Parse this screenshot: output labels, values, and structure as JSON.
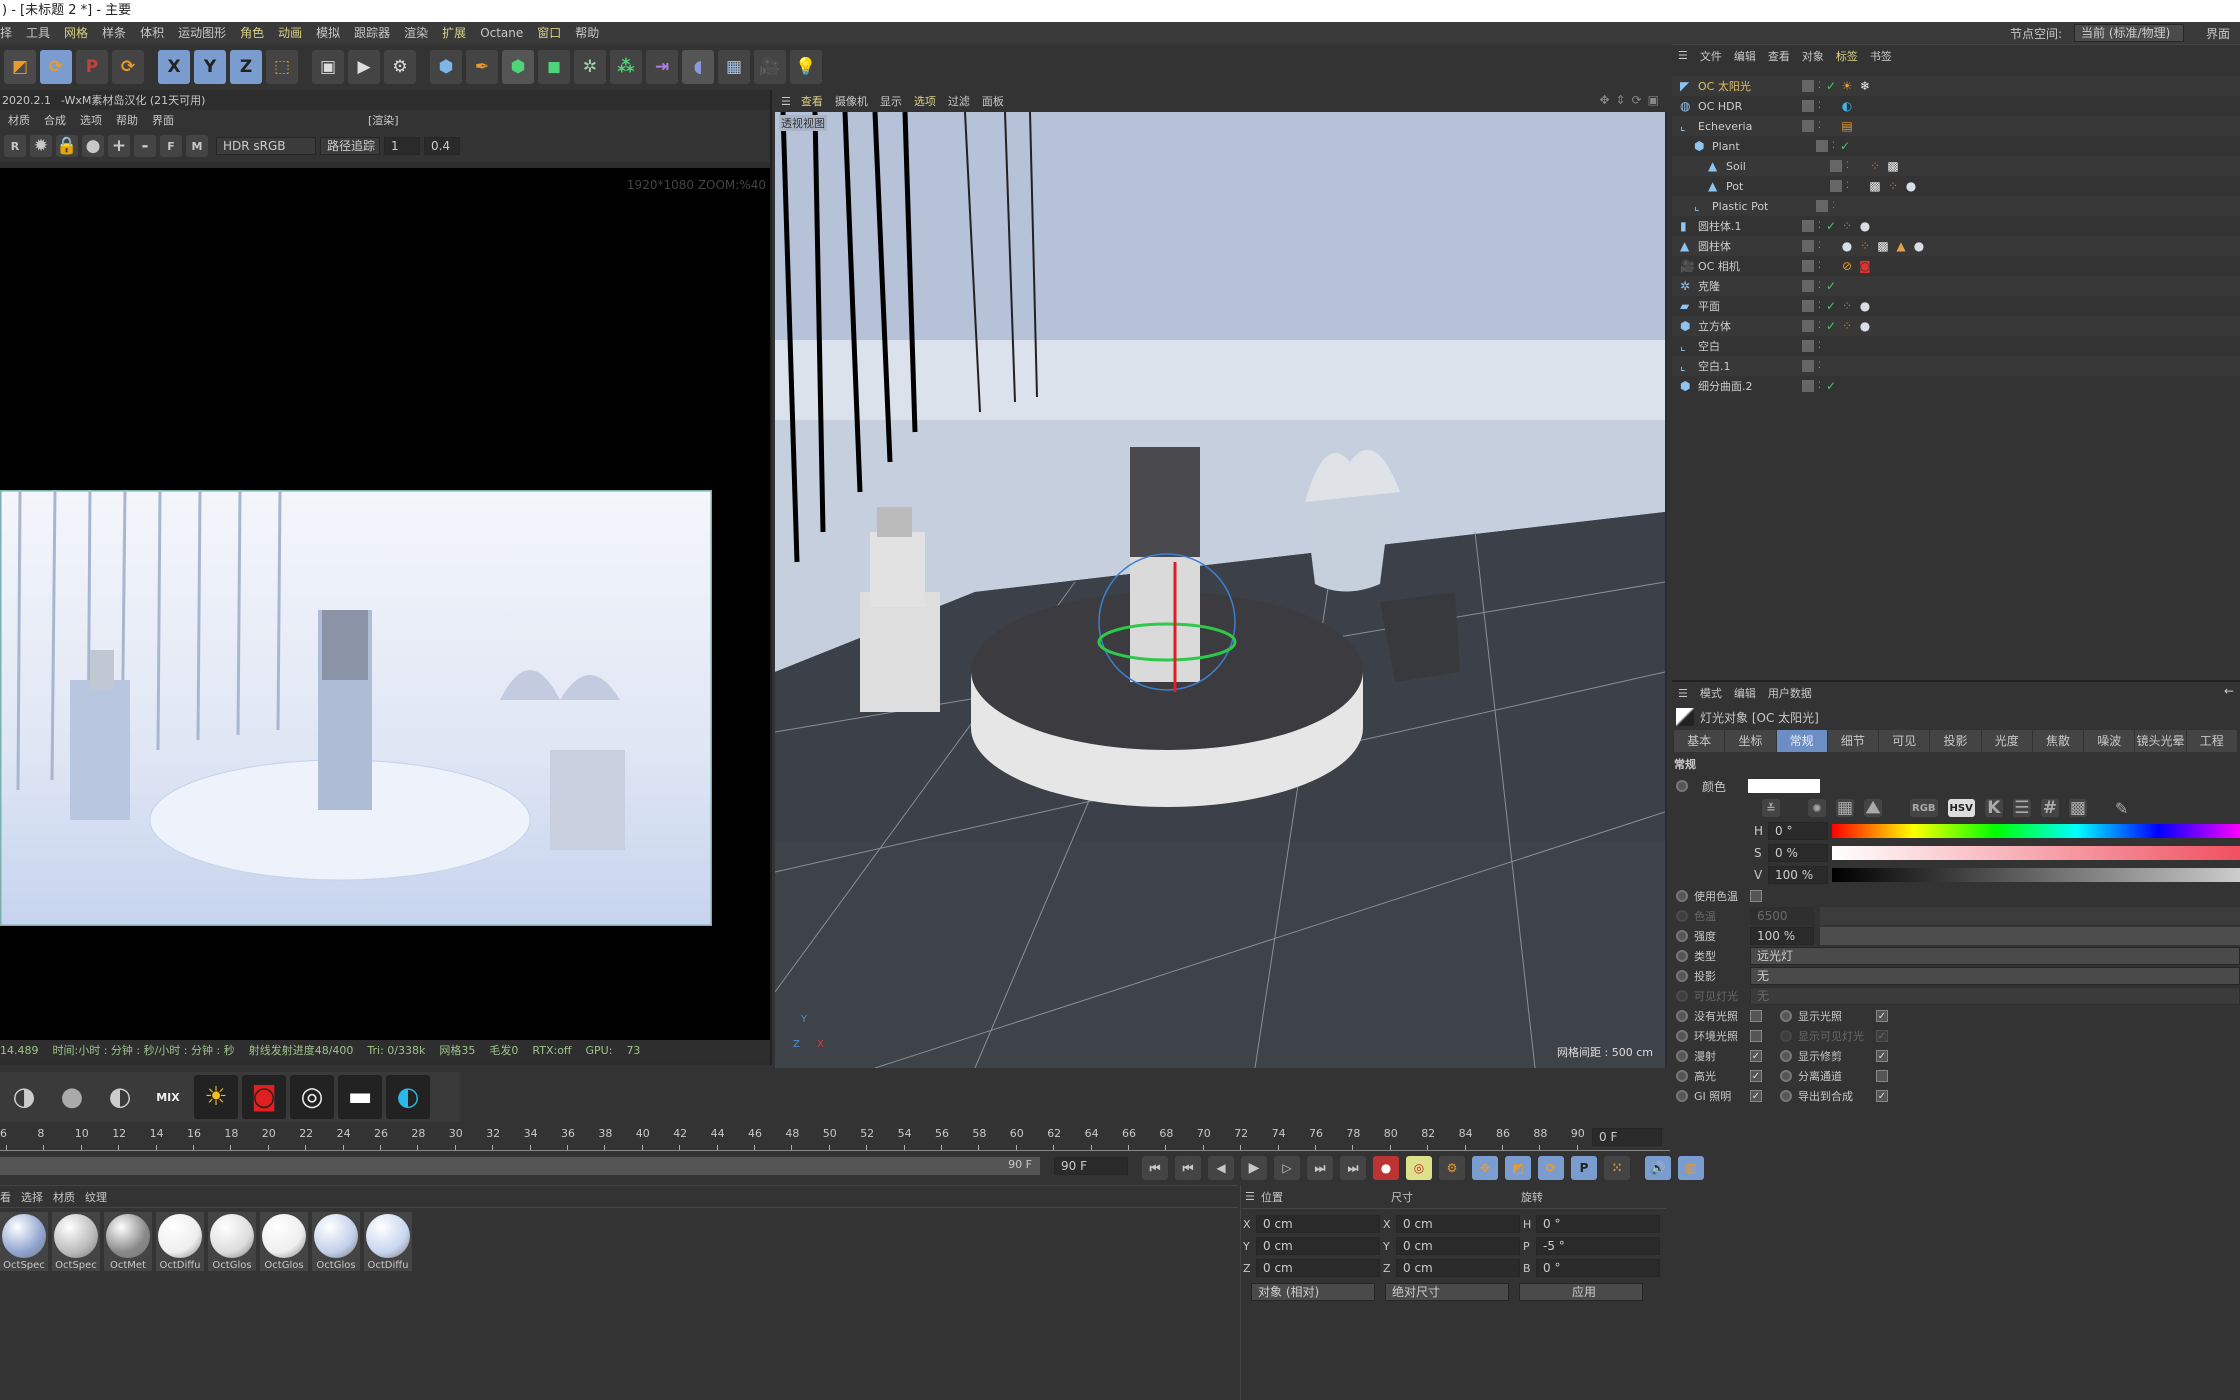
{
  "title": ") - [未标题 2 *] - 主要",
  "menu": [
    {
      "label": "择",
      "hl": false
    },
    {
      "label": "工具",
      "hl": false
    },
    {
      "label": "网格",
      "hl": true
    },
    {
      "label": "样条",
      "hl": false
    },
    {
      "label": "体积",
      "hl": false
    },
    {
      "label": "运动图形",
      "hl": false
    },
    {
      "label": "角色",
      "hl": true
    },
    {
      "label": "动画",
      "hl": true
    },
    {
      "label": "模拟",
      "hl": false
    },
    {
      "label": "跟踪器",
      "hl": false
    },
    {
      "label": "渲染",
      "hl": false
    },
    {
      "label": "扩展",
      "hl": true
    },
    {
      "label": "Octane",
      "hl": false
    },
    {
      "label": "窗口",
      "hl": true
    },
    {
      "label": "帮助",
      "hl": false
    }
  ],
  "node_space": {
    "label": "节点空间:",
    "value": "当前 (标准/物理)",
    "layout": "界面"
  },
  "toolbar": [
    {
      "name": "scale-icon",
      "glyph": "◩",
      "bg": "#4a4a4a",
      "fg": "#e89a2c"
    },
    {
      "name": "rotate-icon",
      "glyph": "⟳",
      "bg": "#7b9ccf",
      "fg": "#e89a2c"
    },
    {
      "name": "psr-icon",
      "glyph": "P",
      "bg": "#444",
      "fg": "#c0443a"
    },
    {
      "name": "recent-tool-icon",
      "glyph": "⟳",
      "bg": "#444",
      "fg": "#e89a2c"
    },
    {
      "sep": true
    },
    {
      "name": "x-axis-icon",
      "glyph": "X",
      "bg": "#7b9ccf",
      "fg": "#222"
    },
    {
      "name": "y-axis-icon",
      "glyph": "Y",
      "bg": "#7b9ccf",
      "fg": "#222"
    },
    {
      "name": "z-axis-icon",
      "glyph": "Z",
      "bg": "#7b9ccf",
      "fg": "#222"
    },
    {
      "name": "coordinate-system-icon",
      "glyph": "⬚",
      "bg": "#444",
      "fg": "#e89a2c"
    },
    {
      "sep": true
    },
    {
      "name": "render-region-icon",
      "glyph": "▣",
      "bg": "#444",
      "fg": "#ddd"
    },
    {
      "name": "render-view-icon",
      "glyph": "▶",
      "bg": "#444",
      "fg": "#ddd"
    },
    {
      "name": "render-settings-icon",
      "glyph": "⚙",
      "bg": "#444",
      "fg": "#ddd"
    },
    {
      "sep": true
    },
    {
      "name": "cube-icon",
      "glyph": "⬢",
      "bg": "#444",
      "fg": "#7fb6e8"
    },
    {
      "name": "pen-icon",
      "glyph": "✒",
      "bg": "#444",
      "fg": "#e89a2c"
    },
    {
      "name": "subdivision-icon",
      "glyph": "⬢",
      "bg": "#555",
      "fg": "#4fd47a"
    },
    {
      "name": "extrude-icon",
      "glyph": "◼",
      "bg": "#444",
      "fg": "#4fd47a"
    },
    {
      "name": "cloner-icon",
      "glyph": "✲",
      "bg": "#444",
      "fg": "#9fd4a8"
    },
    {
      "name": "mograph-icon",
      "glyph": "⁂",
      "bg": "#444",
      "fg": "#4fd47a"
    },
    {
      "name": "deformer-icon",
      "glyph": "⇥",
      "bg": "#444",
      "fg": "#b07fe0"
    },
    {
      "name": "field-icon",
      "glyph": "◖",
      "bg": "#555",
      "fg": "#8a9ae0"
    },
    {
      "name": "floor-icon",
      "glyph": "▦",
      "bg": "#444",
      "fg": "#a8c4e8"
    },
    {
      "name": "camera-icon",
      "glyph": "🎥",
      "bg": "#444",
      "fg": "#ddd"
    },
    {
      "name": "light-icon",
      "glyph": "💡",
      "bg": "#444",
      "fg": "#ddd"
    }
  ],
  "render_panel": {
    "version": "2020.2.1",
    "license": "-WxM素材岛汉化 (21天可用)",
    "menu": [
      "材质",
      "合成",
      "选项",
      "帮助",
      "界面"
    ],
    "tag": "[渲染]",
    "color_space": "HDR sRGB",
    "mode": "路径追踪",
    "value1": "1",
    "value2": "0.4",
    "resolution": "1920*1080 ZOOM:%40",
    "status": [
      "14.489",
      "时间:小时 : 分钟 : 秒/小时 : 分钟 : 秒",
      "射线发射进度48/400",
      "Tri: 0/338k",
      "网格35",
      "毛发0",
      "RTX:off",
      "GPU:",
      "73"
    ]
  },
  "viewport": {
    "menu": [
      {
        "label": "查看",
        "hl": true
      },
      {
        "label": "摄像机",
        "hl": false
      },
      {
        "label": "显示",
        "hl": false
      },
      {
        "label": "选项",
        "hl": true
      },
      {
        "label": "过滤",
        "hl": false
      },
      {
        "label": "面板",
        "hl": false
      }
    ],
    "view_name": "透视视图",
    "grid_spacing": "网格间距 : 500 cm"
  },
  "object_manager": {
    "tabs": [
      {
        "label": "文件",
        "hl": false
      },
      {
        "label": "编辑",
        "hl": false
      },
      {
        "label": "查看",
        "hl": false
      },
      {
        "label": "对象",
        "hl": false
      },
      {
        "label": "标签",
        "hl": true
      },
      {
        "label": "书签",
        "hl": false
      }
    ],
    "objects": [
      {
        "name": "OC 太阳光",
        "depth": 0,
        "icon": "sun-light-icon",
        "color": "#e0c06a",
        "check": true,
        "selected": true,
        "tags": [
          "sun-tag",
          "snowflake-tag"
        ]
      },
      {
        "name": "OC HDR",
        "depth": 0,
        "icon": "sky-icon",
        "color": "#ccc",
        "check": false,
        "tags": [
          "hdr-tag"
        ]
      },
      {
        "name": "Echeveria",
        "depth": 0,
        "icon": "null-icon",
        "color": "#ccc",
        "check": false,
        "tags": [
          "note-tag"
        ]
      },
      {
        "name": "Plant",
        "depth": 1,
        "icon": "subdivision-icon",
        "color": "#ccc",
        "check": true,
        "tags": []
      },
      {
        "name": "Soil",
        "depth": 2,
        "icon": "polygon-icon",
        "color": "#ccc",
        "check": false,
        "tags": [
          "phong-tag",
          "checker-tag"
        ]
      },
      {
        "name": "Pot",
        "depth": 2,
        "icon": "polygon-icon",
        "color": "#ccc",
        "check": false,
        "tags": [
          "checker-tag",
          "phong-tag",
          "material-tag"
        ]
      },
      {
        "name": "Plastic Pot",
        "depth": 1,
        "icon": "null-icon",
        "color": "#ccc",
        "check": false,
        "red": true,
        "tags": []
      },
      {
        "name": "圆柱体.1",
        "depth": 0,
        "icon": "cylinder-icon",
        "color": "#ccc",
        "check": true,
        "tags": [
          "phong-tag",
          "material-tag"
        ]
      },
      {
        "name": "圆柱体",
        "depth": 0,
        "icon": "polygon-icon",
        "color": "#ccc",
        "check": false,
        "tags": [
          "material-tag",
          "phong-tag",
          "checker-tag",
          "triangle-tag",
          "material-tag"
        ]
      },
      {
        "name": "OC 相机",
        "depth": 0,
        "icon": "camera-icon",
        "color": "#ccc",
        "check": false,
        "tags": [
          "protection-tag",
          "camera-tag"
        ]
      },
      {
        "name": "克隆",
        "depth": 0,
        "icon": "cloner-icon",
        "color": "#ccc",
        "check": true,
        "tags": []
      },
      {
        "name": "平面",
        "depth": 0,
        "icon": "plane-icon",
        "color": "#ccc",
        "check": true,
        "tags": [
          "phong-tag",
          "material-tag"
        ]
      },
      {
        "name": "立方体",
        "depth": 0,
        "icon": "cube-icon",
        "color": "#ccc",
        "check": true,
        "tags": [
          "phong-tag",
          "material-tag"
        ]
      },
      {
        "name": "空白",
        "depth": 0,
        "icon": "null-icon",
        "color": "#ccc",
        "check": false,
        "tags": []
      },
      {
        "name": "空白.1",
        "depth": 0,
        "icon": "null-icon",
        "color": "#ccc",
        "check": false,
        "tags": []
      },
      {
        "name": "细分曲面.2",
        "depth": 0,
        "icon": "subdivision-icon",
        "color": "#ccc",
        "check": true,
        "tags": []
      }
    ]
  },
  "attributes": {
    "menu": [
      "模式",
      "编辑",
      "用户数据"
    ],
    "object_title": "灯光对象 [OC 太阳光]",
    "tabs": [
      {
        "label": "基本",
        "active": false
      },
      {
        "label": "坐标",
        "active": false
      },
      {
        "label": "常规",
        "active": true
      },
      {
        "label": "细节",
        "active": false
      },
      {
        "label": "可见",
        "active": false
      },
      {
        "label": "投影",
        "active": false
      },
      {
        "label": "光度",
        "active": false
      },
      {
        "label": "焦散",
        "active": false
      },
      {
        "label": "噪波",
        "active": false
      },
      {
        "label": "镜头光晕",
        "active": false
      },
      {
        "label": "工程",
        "active": false
      }
    ],
    "section": "常规",
    "color_label": "颜色",
    "color_value": "#ffffff",
    "color_modes": [
      "RGB",
      "HSV"
    ],
    "h": "0 °",
    "s": "0 %",
    "v": "100 %",
    "use_temp": "使用色温",
    "temp_label": "色温",
    "temp_value": "6500",
    "intensity_label": "强度",
    "intensity": "100 %",
    "type_label": "类型",
    "type": "远光灯",
    "shadow_label": "投影",
    "shadow": "无",
    "visible_label": "可见灯光",
    "visible": "无",
    "checks_left": [
      {
        "label": "没有光照",
        "on": false
      },
      {
        "label": "环境光照",
        "on": false
      },
      {
        "label": "漫射",
        "on": true
      },
      {
        "label": "高光",
        "on": true
      },
      {
        "label": "GI 照明",
        "on": true
      }
    ],
    "checks_right": [
      {
        "label": "显示光照",
        "on": true,
        "dim": false
      },
      {
        "label": "显示可见灯光",
        "on": true,
        "dim": true
      },
      {
        "label": "显示修剪",
        "on": true,
        "dim": false
      },
      {
        "label": "分离通道",
        "on": false,
        "dim": false
      },
      {
        "label": "导出到合成",
        "on": true,
        "dim": false
      }
    ]
  },
  "oct_toolbar": [
    "diffuse-material-icon",
    "glossy-material-icon",
    "specular-material-icon",
    "mix-material-icon",
    "sun-icon",
    "camera-icon",
    "texture-icon",
    "area-light-icon",
    "hdr-icon"
  ],
  "timeline": {
    "ticks": [
      6,
      8,
      10,
      12,
      14,
      16,
      18,
      20,
      22,
      24,
      26,
      28,
      30,
      32,
      34,
      36,
      38,
      40,
      42,
      44,
      46,
      48,
      50,
      52,
      54,
      56,
      58,
      60,
      62,
      64,
      66,
      68,
      70,
      72,
      74,
      76,
      78,
      80,
      82,
      84,
      86,
      88,
      90
    ],
    "current_frame": "0 F",
    "end_frame": "90 F",
    "end_field": "90 F"
  },
  "materials": {
    "menu": [
      "看",
      "选择",
      "材质",
      "纹理"
    ],
    "items": [
      "OctSpec",
      "OctSpec",
      "OctMet",
      "OctDiffu",
      "OctGlos",
      "OctGlos",
      "OctGlos",
      "OctDiffu"
    ]
  },
  "coords": {
    "headers": [
      "位置",
      "尺寸",
      "旋转"
    ],
    "rows": [
      [
        "X",
        "0 cm",
        "X",
        "0 cm",
        "H",
        "0 °"
      ],
      [
        "Y",
        "0 cm",
        "Y",
        "0 cm",
        "P",
        "-5 °"
      ],
      [
        "Z",
        "0 cm",
        "Z",
        "0 cm",
        "B",
        "0 °"
      ]
    ],
    "mode": "对象 (相对)",
    "size_mode": "绝对尺寸",
    "apply": "应用"
  }
}
